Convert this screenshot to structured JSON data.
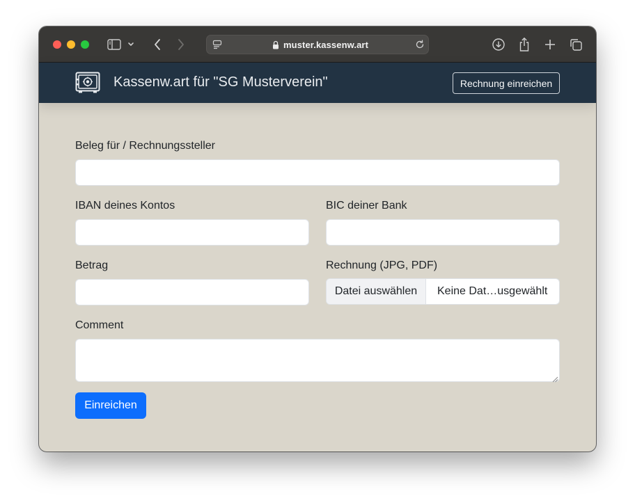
{
  "browser": {
    "url": "muster.kassenw.art",
    "icons": [
      "sidebar-icon",
      "chevron-down-icon",
      "back-icon",
      "forward-icon",
      "page-menu-icon",
      "lock-icon",
      "reload-icon",
      "download-icon",
      "share-icon",
      "new-tab-icon",
      "tabs-overview-icon"
    ]
  },
  "navbar": {
    "logo": "safe-icon",
    "title": "Kassenw.art für \"SG Musterverein\"",
    "button_label": "Rechnung einreichen"
  },
  "form": {
    "beleg": {
      "label": "Beleg für / Rechnungssteller",
      "value": ""
    },
    "iban": {
      "label": "IBAN deines Kontos",
      "value": ""
    },
    "bic": {
      "label": "BIC deiner Bank",
      "value": ""
    },
    "betrag": {
      "label": "Betrag",
      "value": ""
    },
    "rechnung": {
      "label": "Rechnung (JPG, PDF)",
      "choose_label": "Datei auswählen",
      "status": "Keine Dat…usgewählt"
    },
    "comment": {
      "label": "Comment",
      "value": ""
    },
    "submit_label": "Einreichen"
  },
  "colors": {
    "navbar": "#223343",
    "background": "#dad6cb",
    "primary": "#0d6efd"
  }
}
